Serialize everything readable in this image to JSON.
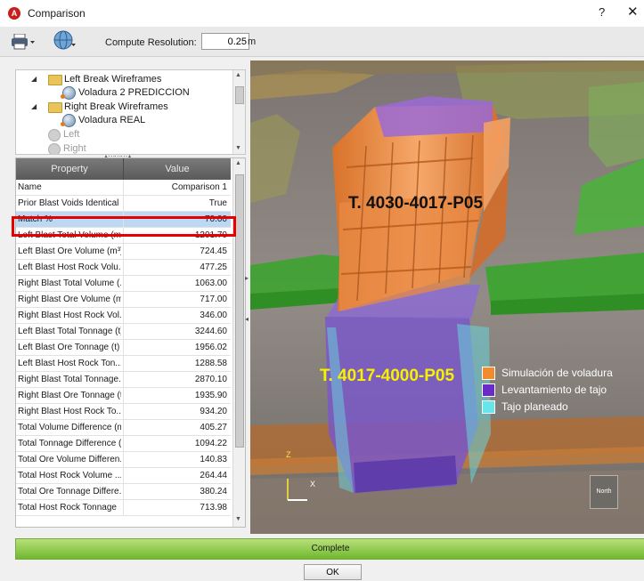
{
  "window": {
    "title": "Comparison",
    "help": "?",
    "close": "✕"
  },
  "toolbar": {
    "resolution_label": "Compute Resolution:",
    "resolution_value": "0.25",
    "resolution_unit": "m"
  },
  "tree": {
    "items": [
      {
        "label": "Left Break Wireframes",
        "kind": "folder"
      },
      {
        "label": "Voladura 2 PREDICCION",
        "kind": "wireframe"
      },
      {
        "label": "Right Break Wireframes",
        "kind": "folder"
      },
      {
        "label": "Voladura REAL",
        "kind": "wireframe"
      },
      {
        "label": "Left",
        "kind": "disabled"
      },
      {
        "label": "Right",
        "kind": "disabled"
      }
    ]
  },
  "grid": {
    "header_property": "Property",
    "header_value": "Value",
    "rows": [
      {
        "name": "Name",
        "value": "Comparison 1"
      },
      {
        "name": "Prior Blast Voids Identical",
        "value": "True"
      },
      {
        "name": "Match %",
        "value": "70.00"
      },
      {
        "name": "Left Blast Total Volume (m³)",
        "value": "1201.70"
      },
      {
        "name": "Left Blast Ore Volume (m³)",
        "value": "724.45"
      },
      {
        "name": "Left Blast Host Rock Volu...",
        "value": "477.25"
      },
      {
        "name": "Right Blast Total Volume (...",
        "value": "1063.00"
      },
      {
        "name": "Right Blast Ore Volume (m³)",
        "value": "717.00"
      },
      {
        "name": "Right Blast Host Rock Vol...",
        "value": "346.00"
      },
      {
        "name": "Left Blast Total Tonnage (t)",
        "value": "3244.60"
      },
      {
        "name": "Left Blast Ore Tonnage (t)",
        "value": "1956.02"
      },
      {
        "name": "Left Blast Host Rock Ton...",
        "value": "1288.58"
      },
      {
        "name": "Right Blast Total Tonnage...",
        "value": "2870.10"
      },
      {
        "name": "Right Blast Ore Tonnage (t)",
        "value": "1935.90"
      },
      {
        "name": "Right Blast Host Rock To...",
        "value": "934.20"
      },
      {
        "name": "Total Volume Difference (m³)",
        "value": "405.27"
      },
      {
        "name": "Total Tonnage Difference (t)",
        "value": "1094.22"
      },
      {
        "name": "Total Ore Volume Differen...",
        "value": "140.83"
      },
      {
        "name": "Total Host Rock Volume ...",
        "value": "264.44"
      },
      {
        "name": "Total Ore Tonnage Differe...",
        "value": "380.24"
      },
      {
        "name": "Total Host Rock Tonnage",
        "value": "713.98"
      }
    ]
  },
  "view": {
    "label_top": "T. 4030-4017-P05",
    "label_bottom": "T. 4017-4000-P05",
    "legend": [
      {
        "label": "Simulación de voladura",
        "color": "#f28a2e"
      },
      {
        "label": "Levantamiento de tajo",
        "color": "#6a2bc9"
      },
      {
        "label": "Tajo planeado",
        "color": "#66e6ea"
      }
    ],
    "axis_z": "Z",
    "axis_x": "X",
    "north": "North"
  },
  "status": {
    "progress_label": "Complete",
    "progress": 1.0
  },
  "buttons": {
    "ok": "OK"
  }
}
